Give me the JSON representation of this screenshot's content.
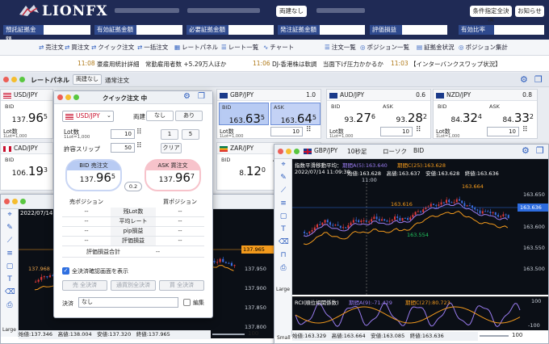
{
  "header": {
    "brand": "LIONFX",
    "rate_status": "両建なし",
    "btn_condition_all": "条件指定全決済",
    "btn_notice": "お知らせ"
  },
  "accounts": [
    {
      "label": "預託証拠金額"
    },
    {
      "label": "有効証拠金額"
    },
    {
      "label": "必要証拠金額"
    },
    {
      "label": "発注証拠金額"
    },
    {
      "label": "評価損益"
    },
    {
      "label": "有効比率"
    }
  ],
  "toolbar": [
    {
      "icon": "sell-icon",
      "label": "売注文"
    },
    {
      "icon": "buy-icon",
      "label": "買注文"
    },
    {
      "icon": "quick-order-icon",
      "label": "クイック注文"
    },
    {
      "icon": "bulk-order-icon",
      "label": "一括注文"
    },
    {
      "icon": "rate-panel-icon",
      "label": "レートパネル"
    },
    {
      "icon": "rate-list-icon",
      "label": "レート一覧"
    },
    {
      "icon": "chart-icon",
      "label": "チャート"
    },
    {
      "icon": "order-list-icon",
      "label": "注文一覧"
    },
    {
      "icon": "position-list-icon",
      "label": "ポジション一覧"
    },
    {
      "icon": "margin-status-icon",
      "label": "証拠金状況"
    },
    {
      "icon": "position-summary-icon",
      "label": "ポジション集計"
    }
  ],
  "ticker": [
    {
      "time": "11:08",
      "text": "豪雇用統計詳細　常勤雇用者数 +5.29万人ほか"
    },
    {
      "time": "11:06",
      "text": "DJ-香港株は軟調　当面下げ圧力かかるか"
    },
    {
      "time": "11:03",
      "text": "【インターバンクスワップ状況】"
    }
  ],
  "rate_panel": {
    "title": "レートパネル",
    "hedge": "両建なし",
    "mode": "通常注文",
    "bid_label": "BID",
    "ask_label": "ASK",
    "lot_label": "Lot数",
    "lot_sub": "1Lot=1,000",
    "pairs": [
      {
        "name": "USD/JPY",
        "spread": "",
        "bid": [
          "137.",
          "96",
          "5"
        ],
        "ask": [
          "",
          "",
          ""
        ],
        "lot": ""
      },
      {
        "name": "GBP/JPY",
        "spread": "1.0",
        "bid": [
          "163.",
          "63",
          "5"
        ],
        "ask": [
          "163.",
          "64",
          "5"
        ],
        "lot": "10"
      },
      {
        "name": "AUD/JPY",
        "spread": "0.6",
        "bid": [
          "93.",
          "27",
          "6"
        ],
        "ask": [
          "93.",
          "28",
          "2"
        ],
        "lot": "10"
      },
      {
        "name": "NZD/JPY",
        "spread": "0.8",
        "bid": [
          "84.",
          "32",
          "4"
        ],
        "ask": [
          "84.",
          "33",
          "2"
        ],
        "lot": "10"
      },
      {
        "name": "CAD/JPY",
        "spread": "",
        "bid": [
          "106.",
          "19",
          "3"
        ],
        "ask": [
          "",
          "",
          ""
        ],
        "lot": ""
      },
      {
        "name": "ZAR/JPY",
        "spread": "",
        "bid": [
          "8.",
          "12",
          "0"
        ],
        "ask": [
          "",
          "",
          ""
        ],
        "lot": ""
      }
    ]
  },
  "quick_order": {
    "title": "クイック注文 中",
    "pair": "USD/JPY",
    "hedge_label": "両建",
    "hedge_opts": [
      "なし",
      "あり"
    ],
    "lot_label": "Lot数",
    "lot_sub": "1Lot=1,000",
    "lot_value": "10",
    "lot_preset_1": "1",
    "lot_preset_2": "5",
    "slip_label": "許容スリップ",
    "slip_value": "50",
    "clear": "クリア",
    "bid_label": "BID 売注文",
    "bid_price": [
      "137.",
      "96",
      "5"
    ],
    "ask_label": "ASK 買注文",
    "ask_price": [
      "137.",
      "96",
      "7"
    ],
    "spread": "0.2",
    "sell_pos": "売ポジション",
    "buy_pos": "買ポジション",
    "rows": [
      {
        "label": "残Lot数",
        "sell": "--",
        "buy": "--"
      },
      {
        "label": "平均レート",
        "sell": "--",
        "buy": "--"
      },
      {
        "label": "pip損益",
        "sell": "--",
        "buy": "--"
      },
      {
        "label": "評価損益",
        "sell": "--",
        "buy": "--"
      }
    ],
    "total_label": "評価損益合計",
    "total_value": "--",
    "confirm_label": "全決済確認画面を表示",
    "btn_sell_all": "売 全決済",
    "btn_both_all": "通貨別全決済",
    "btn_buy_all": "買 全決済",
    "settle_label": "決済",
    "settle_value": "なし",
    "edit_label": "編集"
  },
  "chart_left": {
    "date": "2022/07/14 11",
    "current": "137.965",
    "hi_label": "137.968",
    "ticks": [
      "137.950",
      "137.900",
      "137.850",
      "137.800"
    ],
    "status": "始値:137.346　高値:138.004　安値:137.320　終値:137.965",
    "zoom": "100",
    "size": "Large"
  },
  "chart_right": {
    "pair": "GBP/JPY",
    "interval": "10秒足",
    "chart_kind": "ローソク",
    "side": "BID",
    "ma_title": "指数平滑移動平均：",
    "ma_a": "期間A(5):163.640",
    "ma_b": "期間C(25):163.628",
    "date": "2022/07/14 11:09:30",
    "ohlc_top": "始値:163.628　高値:163.637　安値:163.628　終値:163.636",
    "time_label": "11:00",
    "hi": "163.664",
    "mid1": "163.616",
    "lo": "163.554",
    "current": "163.636",
    "ticks": [
      "163.650",
      "163.600",
      "163.550",
      "163.500"
    ],
    "rci_title": "RCI(順位相関係数)",
    "rci_a": "期間A(9):-71.429",
    "rci_c": "期間C(27):80.723",
    "rci_ticks": [
      "100",
      "-100"
    ],
    "status": "始値:163.329　高値:163.664　安値:163.085　終値:163.636",
    "zoom": "100",
    "sizes": [
      "Large",
      "Small"
    ]
  }
}
